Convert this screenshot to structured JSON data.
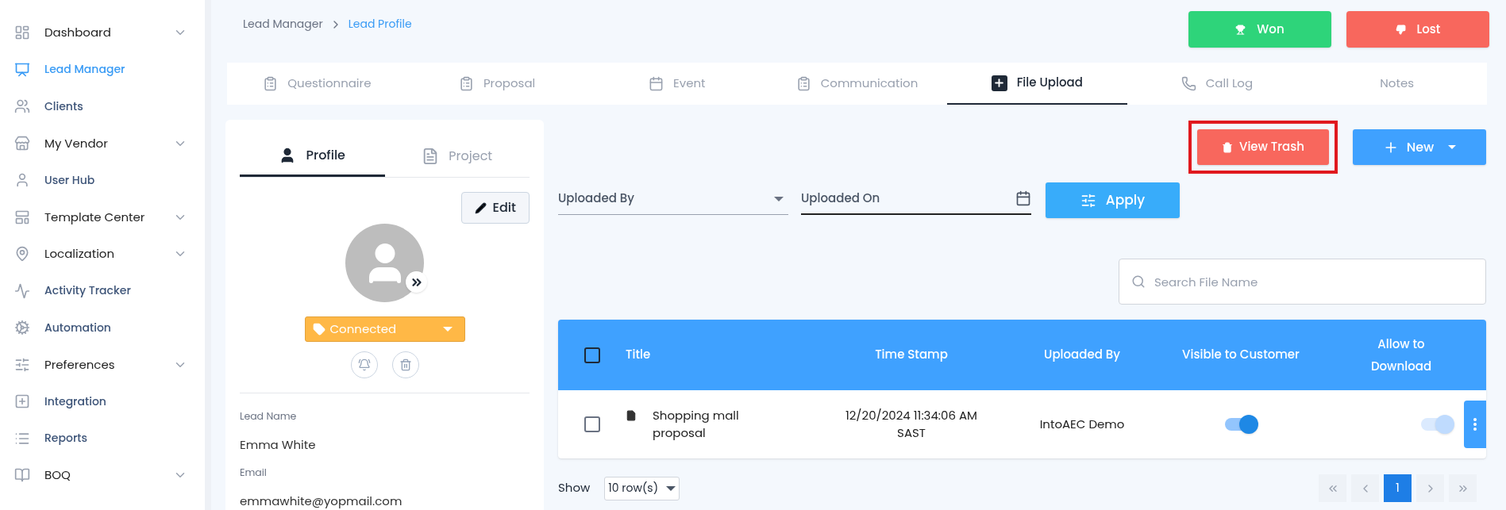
{
  "sidebar": {
    "items": [
      {
        "label": "Dashboard",
        "expandable": true,
        "selected": false
      },
      {
        "label": "Lead Manager",
        "expandable": false,
        "selected": true
      },
      {
        "label": "Clients",
        "expandable": false,
        "selected": false
      },
      {
        "label": "My Vendor",
        "expandable": true,
        "selected": false
      },
      {
        "label": "User Hub",
        "expandable": false,
        "selected": false
      },
      {
        "label": "Template Center",
        "expandable": true,
        "selected": false
      },
      {
        "label": "Localization",
        "expandable": true,
        "selected": false
      },
      {
        "label": "Activity Tracker",
        "expandable": false,
        "selected": false
      },
      {
        "label": "Automation",
        "expandable": false,
        "selected": false
      },
      {
        "label": "Preferences",
        "expandable": true,
        "selected": false
      },
      {
        "label": "Integration",
        "expandable": false,
        "selected": false
      },
      {
        "label": "Reports",
        "expandable": false,
        "selected": false
      },
      {
        "label": "BOQ",
        "expandable": true,
        "selected": false
      }
    ]
  },
  "breadcrumb": [
    "Lead Manager",
    "Lead Profile"
  ],
  "header_buttons": [
    {
      "label": "Won",
      "kind": "won"
    },
    {
      "label": "Lost",
      "kind": "lost"
    }
  ],
  "tabs": [
    {
      "label": "Questionnaire",
      "selected": false
    },
    {
      "label": "Proposal",
      "selected": false
    },
    {
      "label": "Event",
      "selected": false
    },
    {
      "label": "Communication",
      "selected": false
    },
    {
      "label": "File Upload",
      "selected": true
    },
    {
      "label": "Call Log",
      "selected": false
    },
    {
      "label": "Notes",
      "selected": false
    }
  ],
  "profile": {
    "tabs": [
      {
        "label": "Profile",
        "selected": true
      },
      {
        "label": "Project",
        "selected": false
      }
    ],
    "edit_button": "Edit",
    "status": "Connected",
    "fields": [
      {
        "label": "Lead Name",
        "value": "Emma White"
      },
      {
        "label": "Email",
        "value": "emmawhite@yopmail.com"
      }
    ]
  },
  "toolbar": {
    "view_trash": "View Trash",
    "new": "New"
  },
  "filters": {
    "uploaded_by": "Uploaded By",
    "uploaded_on": "Uploaded On",
    "apply": "Apply"
  },
  "search": {
    "placeholder": "Search File Name"
  },
  "table": {
    "header_checked": false,
    "columns": [
      "Title",
      "Time Stamp",
      "Uploaded By",
      "Visible to Customer",
      "Allow to Download"
    ],
    "rows": [
      {
        "checked": false,
        "title": "Shopping mall proposal",
        "timestamp": "12/20/2024 11:34:06 AM SAST",
        "uploaded_by": "IntoAEC Demo",
        "visible": {
          "on": true,
          "disabled": false
        },
        "download": {
          "on": true,
          "disabled": true
        }
      }
    ]
  },
  "footer": {
    "show_label": "Show",
    "rows_per_page": "10 row(s)",
    "pages": [
      {
        "label": "1",
        "selected": true
      }
    ]
  }
}
